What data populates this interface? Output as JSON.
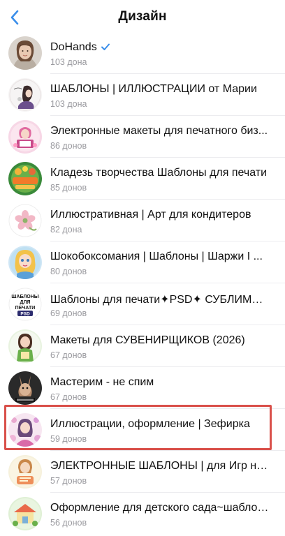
{
  "header": {
    "title": "Дизайн"
  },
  "channels": [
    {
      "name": "DoHands",
      "subs": "103 дона",
      "verified": true,
      "avatar": "dohands-avatar"
    },
    {
      "name": "ШАБЛОНЫ | ИЛЛЮСТРАЦИИ от Марии",
      "subs": "103 дона",
      "avatar": "maria-avatar"
    },
    {
      "name": "Электронные макеты для печатного биз...",
      "subs": "86 донов",
      "avatar": "print-layouts-avatar"
    },
    {
      "name": "Кладезь творчества Шаблоны для печати",
      "subs": "85 донов",
      "avatar": "kladez-avatar"
    },
    {
      "name": "Иллюстративная | Арт для кондитеров",
      "subs": "82 дона",
      "avatar": "flower-avatar"
    },
    {
      "name": "Шокобоксомания | Шаблоны | Шаржи I ...",
      "subs": "80 донов",
      "avatar": "chocobox-avatar"
    },
    {
      "name": "Шаблоны для печати✦PSD✦ СУБЛИМАЦ...",
      "subs": "69 донов",
      "avatar": "psd-avatar",
      "avatar_text": [
        "ШАБЛОНЫ",
        "ДЛЯ",
        "ПЕЧАТИ",
        "PSD"
      ]
    },
    {
      "name": "Макеты для СУВЕНИРЩИКОВ (2026)",
      "subs": "67 донов",
      "avatar": "souvenir-avatar"
    },
    {
      "name": "Мастерим - не спим",
      "subs": "67 донов",
      "avatar": "masterim-avatar"
    },
    {
      "name": "Иллюстрации, оформление | Зефирка",
      "subs": "59 донов",
      "avatar": "zefirka-avatar"
    },
    {
      "name": "ЭЛЕКТРОННЫЕ ШАБЛОНЫ | для Игр на ...",
      "subs": "57 донов",
      "avatar": "games-avatar"
    },
    {
      "name": "Оформление для детского сада~шаблоны",
      "subs": "56 донов",
      "avatar": "kindergarten-avatar"
    }
  ],
  "colors": {
    "accent": "#3a8eea",
    "highlight": "#d9504a",
    "secondary_text": "#9a9a9f"
  },
  "icons": {
    "back": "chevron-left-icon",
    "verified": "verified-badge-icon"
  }
}
